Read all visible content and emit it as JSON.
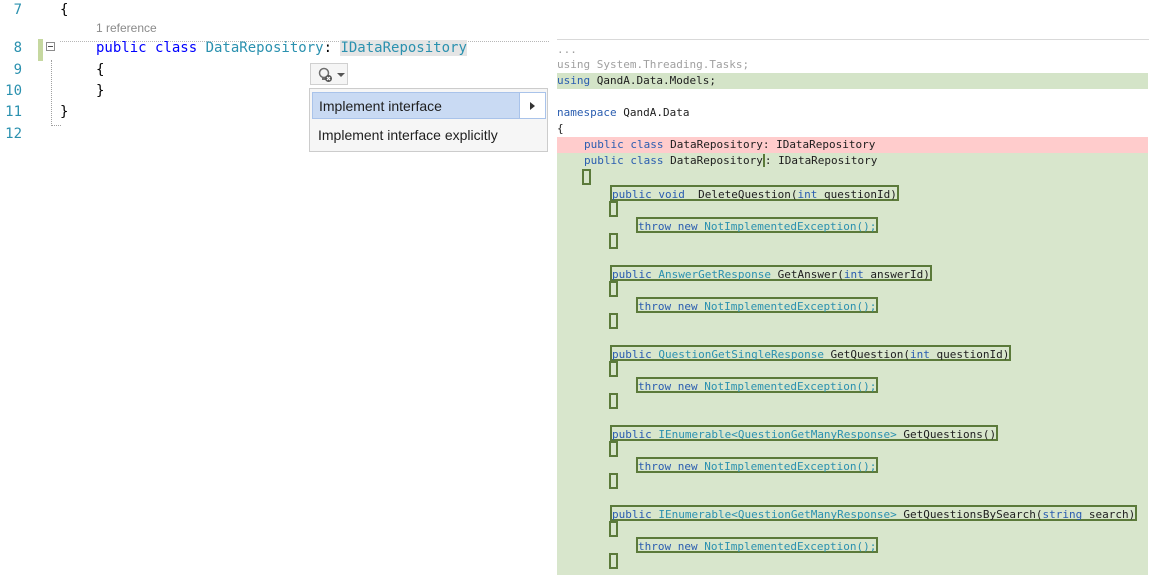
{
  "editor": {
    "lines": [
      {
        "num": "7",
        "text": "{"
      },
      {
        "num": "8",
        "kw": "public class ",
        "name": "DataRepository",
        "sep": ": ",
        "iface": "IDataRepository"
      },
      {
        "num": "9",
        "text": "{"
      },
      {
        "num": "10",
        "text": "}"
      },
      {
        "num": "11",
        "text": "}"
      },
      {
        "num": "12",
        "text": ""
      }
    ],
    "codelens": "1 reference",
    "bulb_icon": "lightbulb-error-icon"
  },
  "quick_actions": {
    "items": [
      {
        "label": "Implement interface"
      },
      {
        "label": "Implement interface explicitly"
      }
    ]
  },
  "preview": {
    "ellipsis": "...",
    "using1_kw": "using",
    "using1_rest": " System.Threading.Tasks;",
    "using2_kw": "using",
    "using2_rest": " QandA.Data.Models;",
    "namespace_kw": "namespace",
    "namespace_name": " QandA.Data",
    "open_brace": "{",
    "removed_kw": "public class",
    "removed_rest": " DataRepository: IDataRepository",
    "added_kw": "public class",
    "added_name": " DataRepository",
    "added_rest": ": IDataRepository",
    "methods": [
      {
        "kw": "public",
        "ret_kw": "void",
        "ret": "",
        "sig_before": " DeleteQuestion(",
        "ptype": "int",
        "pname": " questionId)"
      },
      {
        "kw": "public",
        "ret_kw": "",
        "ret": " AnswerGetResponse",
        "sig_before": " GetAnswer(",
        "ptype": "int",
        "pname": " answerId)"
      },
      {
        "kw": "public",
        "ret_kw": "",
        "ret": " QuestionGetSingleResponse",
        "sig_before": " GetQuestion(",
        "ptype": "int",
        "pname": " questionId)"
      },
      {
        "kw": "public",
        "ret_kw": "",
        "ret": " IEnumerable<QuestionGetManyResponse>",
        "sig_before": " GetQuestions()",
        "ptype": "",
        "pname": ""
      },
      {
        "kw": "public",
        "ret_kw": "",
        "ret": " IEnumerable<QuestionGetManyResponse>",
        "sig_before": " GetQuestionsBySearch(",
        "ptype": "string",
        "pname": " search)"
      }
    ],
    "throw_kw": "throw new",
    "throw_rest": " NotImplementedException();"
  }
}
